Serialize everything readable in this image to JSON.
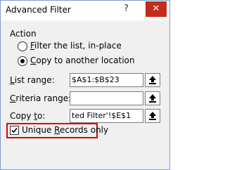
{
  "window": {
    "title": "Advanced Filter",
    "help_icon": "?",
    "close_icon": "✕"
  },
  "action": {
    "label": "Action",
    "options": [
      {
        "key": "F",
        "rest": "ilter the list, in-place",
        "selected": false
      },
      {
        "key": "C",
        "rest": "opy to another location",
        "selected": true
      }
    ]
  },
  "fields": {
    "list_range": {
      "label_key": "L",
      "label_rest": "ist range:",
      "value": "$A$1:$B$23"
    },
    "criteria_range": {
      "label_key": "C",
      "label_rest": "riteria range:",
      "value": ""
    },
    "copy_to": {
      "label_pre": "Copy ",
      "label_key": "t",
      "label_rest": "o:",
      "value": "ted Filter'!$E$1"
    }
  },
  "unique": {
    "label_key": "R",
    "label_pre": "Unique ",
    "label_rest": "ecords only",
    "checked": true
  },
  "colors": {
    "highlight": "#e00000",
    "close_bg": "#c42b1c",
    "border": "#7a9ec9"
  },
  "icons": {
    "ref_button": "collapse-dialog-icon",
    "check": "check-icon"
  }
}
